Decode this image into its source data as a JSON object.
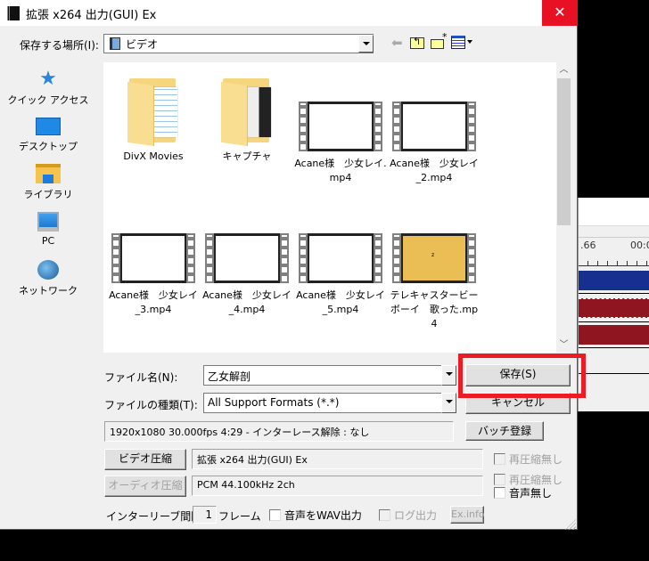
{
  "window": {
    "title": "拡張 x264 出力(GUI) Ex",
    "close_label": "✕"
  },
  "location": {
    "label": "保存する場所(I):",
    "value": "ビデオ"
  },
  "toolbar_icons": [
    "back-arrow-icon",
    "up-folder-icon",
    "new-folder-icon",
    "view-menu-icon"
  ],
  "places": [
    {
      "label": "クイック アクセス",
      "icon": "star-icon"
    },
    {
      "label": "デスクトップ",
      "icon": "desktop-icon"
    },
    {
      "label": "ライブラリ",
      "icon": "library-icon"
    },
    {
      "label": "PC",
      "icon": "pc-icon"
    },
    {
      "label": "ネットワーク",
      "icon": "network-icon"
    }
  ],
  "files": [
    {
      "name": "DivX Movies",
      "type": "folder"
    },
    {
      "name": "キャプチャ",
      "type": "folder"
    },
    {
      "name": "Acane様　少女レイ.mp4",
      "type": "video"
    },
    {
      "name": "Acane様　少女レイ_2.mp4",
      "type": "video"
    },
    {
      "name": "Acane様　少女レイ_3.mp4",
      "type": "video"
    },
    {
      "name": "Acane様　少女レイ_4.mp4",
      "type": "video"
    },
    {
      "name": "Acane様　少女レイ_5.mp4",
      "type": "video"
    },
    {
      "name": "テレキャスタービーボーイ　歌った.mp4",
      "type": "video"
    }
  ],
  "filename": {
    "label": "ファイル名(N):",
    "value": "乙女解剖"
  },
  "filetype": {
    "label": "ファイルの種類(T):",
    "value": "All Support Formats (*.*)"
  },
  "buttons": {
    "save": "保存(S)",
    "cancel": "キャンセル",
    "batch": "バッチ登録",
    "video_compress": "ビデオ圧縮",
    "audio_compress": "オーディオ圧縮",
    "exinfo": "Ex.info"
  },
  "info_text": "1920x1080  30.000fps  4:29  -  インターレース解除 : なし",
  "video_codec": "拡張 x264 出力(GUI) Ex",
  "audio_codec": "PCM 44.100kHz 2ch",
  "checkboxes": {
    "video_no_recompress": {
      "label": "再圧縮無し",
      "checked": false,
      "enabled": false
    },
    "audio_no_recompress": {
      "label": "再圧縮無し",
      "checked": false,
      "enabled": false
    },
    "no_audio": {
      "label": "音声無し",
      "checked": false,
      "enabled": true
    },
    "wav_output": {
      "label": "音声をWAV出力",
      "checked": false,
      "enabled": true
    },
    "log_output": {
      "label": "ログ出力",
      "checked": false,
      "enabled": false
    }
  },
  "interleave": {
    "label": "インターリーブ間隔 :",
    "value": "1",
    "unit": "フレーム"
  },
  "background_app": {
    "ruler_labels": [
      ".66",
      "00:0"
    ]
  }
}
